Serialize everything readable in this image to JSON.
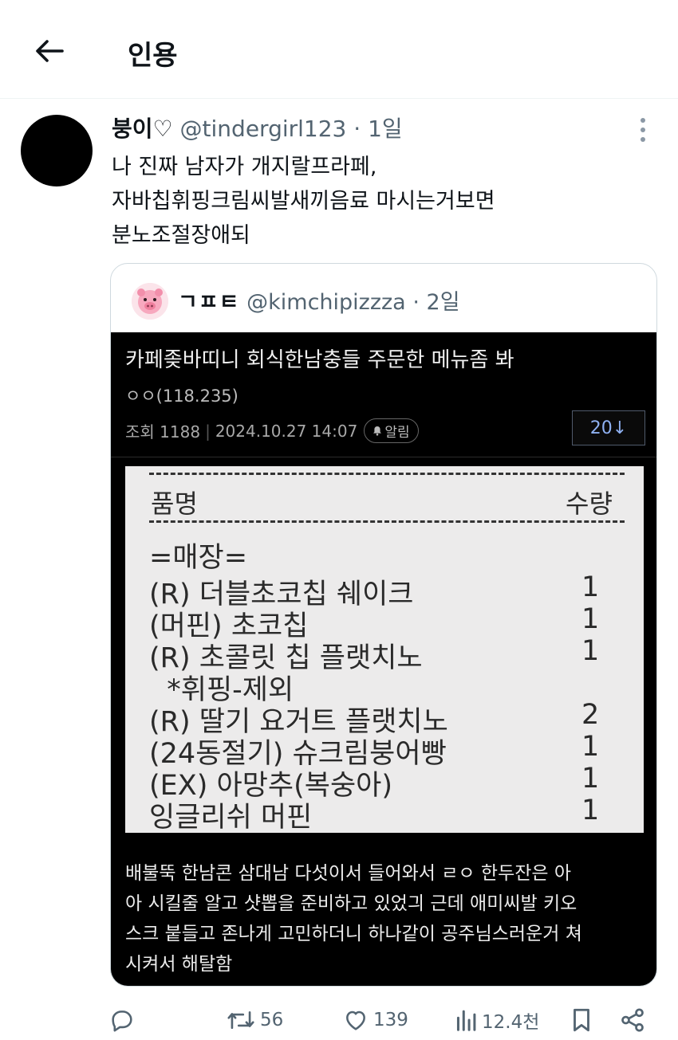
{
  "header": {
    "title": "인용"
  },
  "tweet": {
    "name": "붕이",
    "heart": "♡",
    "handle": "@tindergirl123",
    "separator": "·",
    "age": "1일",
    "text": "나 진짜 남자가 개지랄프라페,\n자바칩휘핑크림씨발새끼음료 마시는거보면\n분노조절장애되"
  },
  "quoted": {
    "name": "ㄱㅍㅌ",
    "handle": "@kimchipizzza",
    "separator": "·",
    "age": "2일",
    "post": {
      "title": "카페좆바띠니 회식한남충들 주문한 메뉴좀 봐",
      "author": "ㅇㅇ(118.235)",
      "views_label": "조회 1188",
      "datetime": "2024.10.27 14:07",
      "alarm_label": "알림",
      "comment_button": "20↓",
      "receipt": {
        "col_name": "품명",
        "col_qty": "수량",
        "items": [
          {
            "name": "=매장=",
            "qty": ""
          },
          {
            "name": "(R) 더블초코칩 쉐이크",
            "qty": "1"
          },
          {
            "name": "(머핀) 초코칩",
            "qty": "1"
          },
          {
            "name": "(R) 초콜릿 칩 플랫치노",
            "qty": "1"
          },
          {
            "name": "  *휘핑-제외",
            "qty": ""
          },
          {
            "name": "(R) 딸기 요거트 플랫치노",
            "qty": "2"
          },
          {
            "name": "(24동절기) 슈크림붕어빵",
            "qty": "1"
          },
          {
            "name": "(EX) 아망추(복숭아)",
            "qty": "1"
          },
          {
            "name": "잉글리쉬 머핀",
            "qty": "1"
          }
        ]
      },
      "body": "배불뚝 한남콘 삼대남 다섯이서 들어와서 ㄹㅇ 한두잔은 아\n아 시킬줄 알고 샷뽑을 준비하고 있었긔 근데 애미씨발 키오\n스크 붙들고 존나게 고민하더니 하나같이 공주님스러운거 쳐\n시켜서 해탈함"
    }
  },
  "actions": {
    "reply_icon": "reply-icon",
    "retweets": "56",
    "likes": "139",
    "views": "12.4천"
  }
}
